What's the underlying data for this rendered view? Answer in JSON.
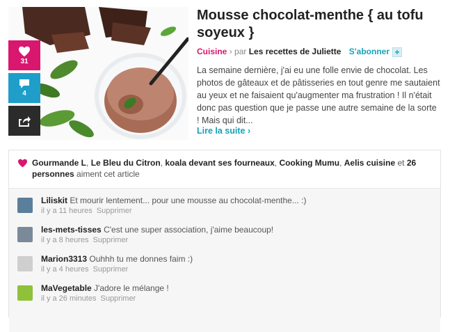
{
  "article": {
    "title": "Mousse chocolat-menthe { au tofu soyeux }",
    "category": "Cuisine",
    "separator": "›",
    "by_label": "par",
    "author": "Les recettes de Juliette",
    "follow_label": "S'abonner",
    "follow_plus": "+",
    "excerpt": "La semaine dernière, j'ai eu une folle envie de chocolat. Les photos de gâteaux et de pâtisseries en tout genre me sautaient au yeux et ne faisaient qu'augmenter ma frustration ! Il n'était donc pas question que je passe une autre semaine de la sorte ! Mais qui dit...",
    "read_more": "Lire la suite ›",
    "image_icon": "chocolate-mousse-photo"
  },
  "actions": {
    "like_count": "31",
    "comment_count": "4",
    "like_icon": "heart-icon",
    "comment_icon": "speech-bubble-icon",
    "share_icon": "share-arrow-icon"
  },
  "likes": {
    "users": [
      "Gourmande L",
      "Le Bleu du Citron",
      "koala devant ses fourneaux",
      "Cooking Mumu",
      "Aelis cuisine"
    ],
    "sep": ", ",
    "and_label": " et ",
    "others_count": "26",
    "others_label": "personnes",
    "suffix": " aiment cet article"
  },
  "comments": [
    {
      "user": "Liliskit",
      "text": "Et mourir lentement... pour une mousse au chocolat-menthe... :)",
      "time": "il y a 11 heures",
      "delete_label": "Supprimer",
      "avatar_color": "#5b7f9b"
    },
    {
      "user": "les-mets-tisses",
      "text": "C'est une super association, j'aime beaucoup!",
      "time": "il y a 8 heures",
      "delete_label": "Supprimer",
      "avatar_color": "#7b8a98"
    },
    {
      "user": "Marion3313",
      "text": "Ouhhh tu me donnes faim :)",
      "time": "il y a 4 heures",
      "delete_label": "Supprimer",
      "avatar_color": "#cfcfcf"
    },
    {
      "user": "MaVegetable",
      "text": "J'adore le mélange !",
      "time": "il y a 26 minutes",
      "delete_label": "Supprimer",
      "avatar_color": "#8fc13a"
    }
  ],
  "colors": {
    "accent_pink": "#d9176f",
    "accent_blue": "#1e9ec8",
    "link_teal": "#17a2b8",
    "share_dark": "#2b2b2b"
  }
}
